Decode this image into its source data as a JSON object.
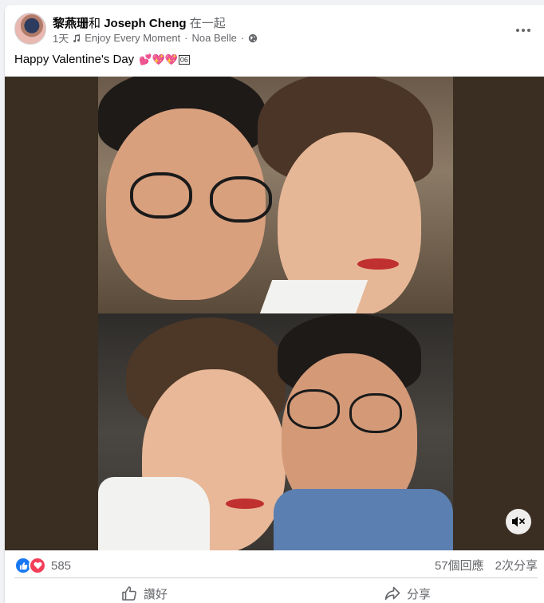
{
  "post": {
    "author": "黎燕珊",
    "with_word": "和",
    "tagged": "Joseph Cheng",
    "together": "在一起",
    "time": "1天",
    "music": "Enjoy Every Moment",
    "dot": "·",
    "artist": "Noa Belle",
    "caption": "Happy Valentine's Day",
    "caption_emojis": "💕💖💖",
    "caption_box": "06"
  },
  "icons": {
    "more": "more-horizontal-icon",
    "music": "music-note-icon",
    "privacy": "globe-icon",
    "mute": "speaker-muted-icon",
    "like_reaction": "thumbs-up-icon",
    "love_reaction": "heart-icon",
    "like_action": "like-outline-icon",
    "share_action": "share-arrow-icon"
  },
  "stats": {
    "reaction_count": "585",
    "comments": "57個回應",
    "shares": "2次分享"
  },
  "actions": {
    "like": "讚好",
    "share": "分享"
  },
  "colors": {
    "like_blue": "#1877f2",
    "love_red": "#f33e58",
    "media_bg": "#3a2e22",
    "meta_grey": "#65676b"
  }
}
